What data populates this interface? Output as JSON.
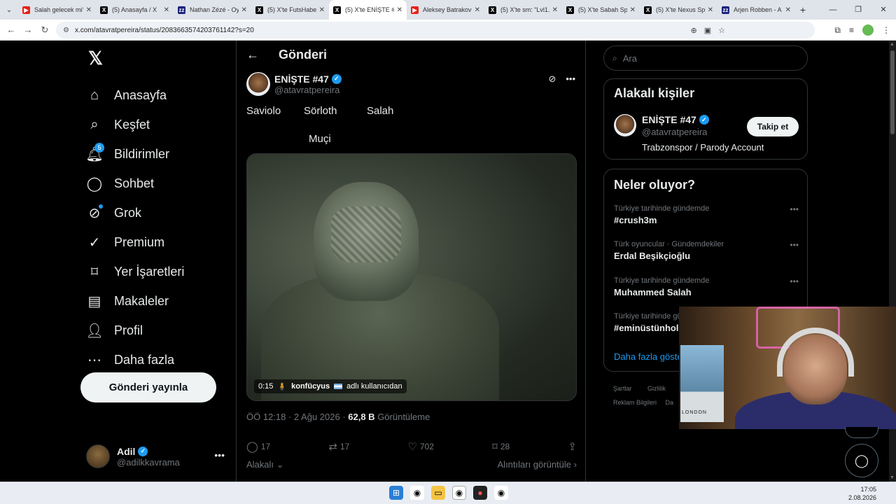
{
  "browser": {
    "tabs": [
      {
        "title": "Salah gelecek mi?",
        "icon": "youtube",
        "active": false
      },
      {
        "title": "(5) Anasayfa / X",
        "icon": "x",
        "active": false
      },
      {
        "title": "Nathan Zézé - Oy",
        "icon": "zz",
        "active": false
      },
      {
        "title": "(5) X'te FutsHaber",
        "icon": "x",
        "active": false
      },
      {
        "title": "(5) X'te ENİŞTE #4",
        "icon": "x",
        "active": true
      },
      {
        "title": "Aleksey Batrakov",
        "icon": "youtube",
        "active": false
      },
      {
        "title": "(5) X'te sm: \"Lvl1.",
        "icon": "x",
        "active": false
      },
      {
        "title": "(5) X'te Sabah Spo",
        "icon": "x",
        "active": false
      },
      {
        "title": "(5) X'te Nexus Spo",
        "icon": "x",
        "active": false
      },
      {
        "title": "Arjen Robben - A",
        "icon": "zz",
        "active": false
      }
    ],
    "url": "x.com/atavratpereira/status/2083663574203761142?s=20"
  },
  "nav": {
    "items": [
      {
        "label": "Anasayfa",
        "icon": "home-icon"
      },
      {
        "label": "Keşfet",
        "icon": "search-icon"
      },
      {
        "label": "Bildirimler",
        "icon": "bell-icon",
        "badge": "5"
      },
      {
        "label": "Sohbet",
        "icon": "chat-icon"
      },
      {
        "label": "Grok",
        "icon": "grok-icon"
      },
      {
        "label": "Premium",
        "icon": "premium-icon"
      },
      {
        "label": "Yer İşaretleri",
        "icon": "bookmark-icon"
      },
      {
        "label": "Makaleler",
        "icon": "articles-icon"
      },
      {
        "label": "Profil",
        "icon": "profile-icon"
      },
      {
        "label": "Daha fazla",
        "icon": "more-circle-icon"
      }
    ],
    "post_button": "Gönderi yayınla",
    "account": {
      "name": "Adil",
      "handle": "@adilkkavrama"
    }
  },
  "main": {
    "title": "Gönderi",
    "author": {
      "name": "ENİŞTE #47",
      "handle": "@atavratpereira"
    },
    "text_words": [
      "Saviolo",
      "Sörloth",
      "Salah",
      "Muçi"
    ],
    "video": {
      "duration": "0:15",
      "credit_name": "konfücyus",
      "credit_suffix": "adlı kullanıcıdan"
    },
    "meta": {
      "time": "ÖÖ 12:18 · 2 Ağu 2026 · ",
      "views": "62,8 B",
      "views_label": " Görüntüleme"
    },
    "stats": {
      "replies": "17",
      "reposts": "17",
      "likes": "702",
      "bookmarks": "28"
    },
    "related": "Alakalı",
    "quotes": "Alıntıları görüntüle"
  },
  "sidebar": {
    "search_placeholder": "Ara",
    "related_title": "Alakalı kişiler",
    "related_person": {
      "name": "ENİŞTE #47",
      "handle": "@atavratpereira",
      "bio": "Trabzonspor / Parody Account",
      "follow": "Takip et"
    },
    "trends_title": "Neler oluyor?",
    "trends": [
      {
        "context": "Türkiye tarihinde gündemde",
        "name": "#crush3m"
      },
      {
        "context": "Türk oyuncular · Gündemdekiler",
        "name": "Erdal Beşikçioğlu"
      },
      {
        "context": "Türkiye tarihinde gündemde",
        "name": "Muhammed Salah"
      },
      {
        "context": "Türkiye tarihinde gü",
        "name": "#eminüstünhol"
      }
    ],
    "show_more": "Daha fazla göster",
    "footer": [
      "Şartlar",
      "Gizlilik",
      "Reklam Bilgileri",
      "Da"
    ]
  },
  "webcam": {
    "poster_text": "LONDON"
  },
  "taskbar": {
    "time": "17:05",
    "date": "2.08.2026"
  }
}
